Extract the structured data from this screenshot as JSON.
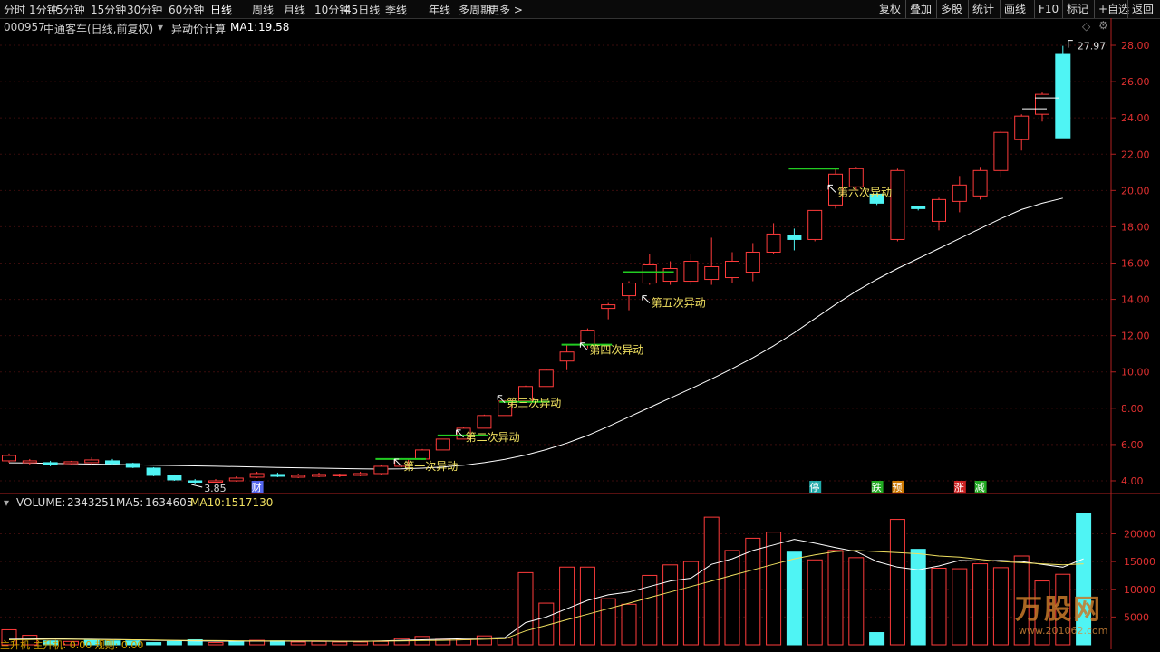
{
  "toolbar": {
    "tabs": [
      "分时",
      "1分钟",
      "5分钟",
      "15分钟",
      "30分钟",
      "60分钟",
      "日线",
      "周线",
      "月线",
      "10分钟",
      "45日线",
      "季线",
      "年线",
      "多周期",
      "更多 >"
    ],
    "active_tab": "日线",
    "right_buttons": [
      "复权",
      "叠加",
      "多股",
      "统计",
      "画线",
      "F10",
      "标记",
      "+自选",
      "返回"
    ]
  },
  "stock": {
    "code": "000957",
    "name": "中通客车(日线,前复权)",
    "indicator": "异动价计算",
    "ma_label": "MA1:",
    "ma_value": "19.58"
  },
  "price_axis": {
    "ticks": [
      "28.00",
      "26.00",
      "24.00",
      "22.00",
      "20.00",
      "18.00",
      "16.00",
      "14.00",
      "12.00",
      "10.00",
      "8.00",
      "6.00",
      "4.00"
    ]
  },
  "price_markers": {
    "high_label": "27.97",
    "low_label": "3.85"
  },
  "annotations": [
    "第一次异动",
    "第二次异动",
    "第三次异动",
    "第四次异动",
    "第五次异动",
    "第六次异动"
  ],
  "event_tags": [
    "财",
    "停",
    "跌",
    "预",
    "涨",
    "减"
  ],
  "volume": {
    "label": "VOLUME:",
    "value": "2343251",
    "ma5_label": "MA5:",
    "ma5_value": "1634605",
    "ma10_label": "MA10:",
    "ma10_value": "1517130",
    "ticks": [
      "20000",
      "15000",
      "10000",
      "5000"
    ]
  },
  "sub_indicator": "主升机  主升机: 0.00  规则: 0.00",
  "watermark": {
    "text": "万股网",
    "url": "www.201062.com"
  },
  "colors": {
    "up": "#ff3b3b",
    "down": "#4ff4f4",
    "ma": "#ffffff",
    "ma10": "#f0e060",
    "annotation": "#f0e060",
    "signal": "#22cc22",
    "background": "#000000"
  },
  "chart_data": {
    "type": "candlestick",
    "ylim": [
      3.5,
      28.5
    ],
    "candles": [
      {
        "o": 5.1,
        "c": 5.4,
        "h": 5.5,
        "l": 5.0
      },
      {
        "o": 5.0,
        "c": 5.1,
        "h": 5.2,
        "l": 4.9
      },
      {
        "o": 5.0,
        "c": 4.9,
        "h": 5.1,
        "l": 4.8
      },
      {
        "o": 4.95,
        "c": 5.05,
        "h": 5.1,
        "l": 4.9
      },
      {
        "o": 5.0,
        "c": 5.15,
        "h": 5.3,
        "l": 4.9
      },
      {
        "o": 5.1,
        "c": 4.95,
        "h": 5.2,
        "l": 4.85
      },
      {
        "o": 4.95,
        "c": 4.75,
        "h": 5.0,
        "l": 4.7
      },
      {
        "o": 4.7,
        "c": 4.3,
        "h": 4.75,
        "l": 4.25
      },
      {
        "o": 4.3,
        "c": 4.05,
        "h": 4.35,
        "l": 4.0
      },
      {
        "o": 4.0,
        "c": 3.97,
        "h": 4.1,
        "l": 3.85
      },
      {
        "o": 3.95,
        "c": 4.0,
        "h": 4.1,
        "l": 3.9
      },
      {
        "o": 4.0,
        "c": 4.15,
        "h": 4.25,
        "l": 3.95
      },
      {
        "o": 4.2,
        "c": 4.4,
        "h": 4.5,
        "l": 4.15
      },
      {
        "o": 4.35,
        "c": 4.25,
        "h": 4.45,
        "l": 4.2
      },
      {
        "o": 4.2,
        "c": 4.3,
        "h": 4.4,
        "l": 4.15
      },
      {
        "o": 4.25,
        "c": 4.35,
        "h": 4.45,
        "l": 4.2
      },
      {
        "o": 4.3,
        "c": 4.35,
        "h": 4.4,
        "l": 4.2
      },
      {
        "o": 4.3,
        "c": 4.4,
        "h": 4.5,
        "l": 4.25
      },
      {
        "o": 4.4,
        "c": 4.8,
        "h": 4.9,
        "l": 4.35
      },
      {
        "o": 4.8,
        "c": 5.2,
        "h": 5.25,
        "l": 4.75
      },
      {
        "o": 5.2,
        "c": 5.7,
        "h": 5.75,
        "l": 5.15
      },
      {
        "o": 5.7,
        "c": 6.3,
        "h": 6.3,
        "l": 5.7
      },
      {
        "o": 6.3,
        "c": 6.9,
        "h": 6.95,
        "l": 6.3
      },
      {
        "o": 6.9,
        "c": 7.6,
        "h": 7.65,
        "l": 6.9
      },
      {
        "o": 7.6,
        "c": 8.4,
        "h": 8.45,
        "l": 7.6
      },
      {
        "o": 8.4,
        "c": 9.2,
        "h": 9.25,
        "l": 8.4
      },
      {
        "o": 9.2,
        "c": 10.1,
        "h": 10.15,
        "l": 9.2
      },
      {
        "o": 10.6,
        "c": 11.1,
        "h": 11.5,
        "l": 10.1
      },
      {
        "o": 11.5,
        "c": 12.3,
        "h": 12.4,
        "l": 11.3
      },
      {
        "o": 13.5,
        "c": 13.7,
        "h": 13.8,
        "l": 12.9
      },
      {
        "o": 14.2,
        "c": 14.9,
        "h": 15.0,
        "l": 13.4
      },
      {
        "o": 14.9,
        "c": 15.9,
        "h": 16.5,
        "l": 14.8
      },
      {
        "o": 15.0,
        "c": 15.7,
        "h": 16.1,
        "l": 14.8
      },
      {
        "o": 15.0,
        "c": 16.1,
        "h": 16.5,
        "l": 14.8
      },
      {
        "o": 15.1,
        "c": 15.8,
        "h": 17.4,
        "l": 14.8
      },
      {
        "o": 15.2,
        "c": 16.1,
        "h": 16.6,
        "l": 14.9
      },
      {
        "o": 15.5,
        "c": 16.6,
        "h": 17.1,
        "l": 15.0
      },
      {
        "o": 16.6,
        "c": 17.6,
        "h": 18.2,
        "l": 16.5
      },
      {
        "o": 17.5,
        "c": 17.3,
        "h": 17.9,
        "l": 16.7
      },
      {
        "o": 17.3,
        "c": 18.9,
        "h": 18.9,
        "l": 17.2
      },
      {
        "o": 19.2,
        "c": 20.9,
        "h": 21.2,
        "l": 19.0
      },
      {
        "o": 20.2,
        "c": 21.2,
        "h": 21.3,
        "l": 20.0
      },
      {
        "o": 19.8,
        "c": 19.3,
        "h": 19.9,
        "l": 19.2
      },
      {
        "o": 17.3,
        "c": 21.1,
        "h": 21.2,
        "l": 17.2
      },
      {
        "o": 19.1,
        "c": 19.0,
        "h": 19.1,
        "l": 18.9
      },
      {
        "o": 18.3,
        "c": 19.5,
        "h": 19.6,
        "l": 17.8
      },
      {
        "o": 19.4,
        "c": 20.3,
        "h": 20.8,
        "l": 18.8
      },
      {
        "o": 19.7,
        "c": 21.1,
        "h": 21.3,
        "l": 19.5
      },
      {
        "o": 21.1,
        "c": 23.2,
        "h": 23.3,
        "l": 20.7
      },
      {
        "o": 22.8,
        "c": 24.1,
        "h": 24.2,
        "l": 22.2
      },
      {
        "o": 24.2,
        "c": 25.3,
        "h": 25.4,
        "l": 23.8
      },
      {
        "o": 27.5,
        "c": 22.9,
        "h": 27.97,
        "l": 22.9
      }
    ],
    "ma": [
      4.99,
      4.98,
      4.96,
      4.94,
      4.92,
      4.9,
      4.88,
      4.86,
      4.84,
      4.82,
      4.8,
      4.78,
      4.76,
      4.74,
      4.72,
      4.7,
      4.68,
      4.66,
      4.65,
      4.66,
      4.7,
      4.76,
      4.86,
      5.0,
      5.18,
      5.42,
      5.72,
      6.08,
      6.5,
      7.0,
      7.52,
      8.04,
      8.56,
      9.08,
      9.62,
      10.18,
      10.78,
      11.44,
      12.16,
      12.94,
      13.72,
      14.45,
      15.1,
      15.7,
      16.25,
      16.8,
      17.35,
      17.9,
      18.45,
      18.95,
      19.3,
      19.58
    ],
    "volume": {
      "values": [
        2700,
        1700,
        700,
        600,
        800,
        700,
        700,
        400,
        600,
        900,
        400,
        600,
        800,
        700,
        500,
        600,
        500,
        500,
        600,
        1100,
        1500,
        1000,
        900,
        1600,
        1200,
        13000,
        7500,
        14000,
        14000,
        8300,
        7300,
        12500,
        14400,
        15000,
        23000,
        17000,
        19200,
        20300,
        16700,
        15300,
        17000,
        15700,
        2200,
        22600,
        17200,
        13800,
        13700,
        14600,
        13900,
        16000,
        11500,
        12700,
        23600
      ],
      "up": [
        true,
        true,
        false,
        true,
        false,
        false,
        false,
        false,
        false,
        false,
        true,
        false,
        true,
        false,
        true,
        true,
        true,
        true,
        true,
        true,
        true,
        true,
        true,
        true,
        true,
        true,
        true,
        true,
        true,
        true,
        true,
        true,
        true,
        true,
        true,
        true,
        true,
        true,
        false,
        true,
        true,
        true,
        false,
        true,
        false,
        true,
        true,
        true,
        true,
        true,
        true,
        true,
        false
      ],
      "ma5": [
        1000,
        1050,
        1100,
        1050,
        1000,
        950,
        900,
        800,
        750,
        700,
        650,
        650,
        650,
        650,
        650,
        650,
        600,
        620,
        680,
        800,
        900,
        1000,
        1100,
        1200,
        1300,
        4000,
        5000,
        6500,
        8000,
        9000,
        9500,
        10500,
        11500,
        12000,
        14500,
        15500,
        17000,
        18000,
        19000,
        18300,
        17500,
        16800,
        15000,
        14000,
        13500,
        14200,
        15200,
        15100,
        15200,
        15000,
        14500,
        14000,
        15500
      ],
      "ma10": [
        900,
        950,
        1000,
        1000,
        950,
        920,
        900,
        850,
        800,
        780,
        750,
        720,
        700,
        700,
        690,
        680,
        650,
        640,
        650,
        700,
        750,
        800,
        900,
        1000,
        1100,
        2500,
        3500,
        4500,
        5500,
        6500,
        7500,
        8500,
        9500,
        10500,
        11500,
        12500,
        13500,
        14500,
        15500,
        16200,
        16800,
        17000,
        16800,
        16600,
        16400,
        16000,
        15800,
        15400,
        15000,
        14800,
        14600,
        14400,
        14600
      ]
    }
  }
}
